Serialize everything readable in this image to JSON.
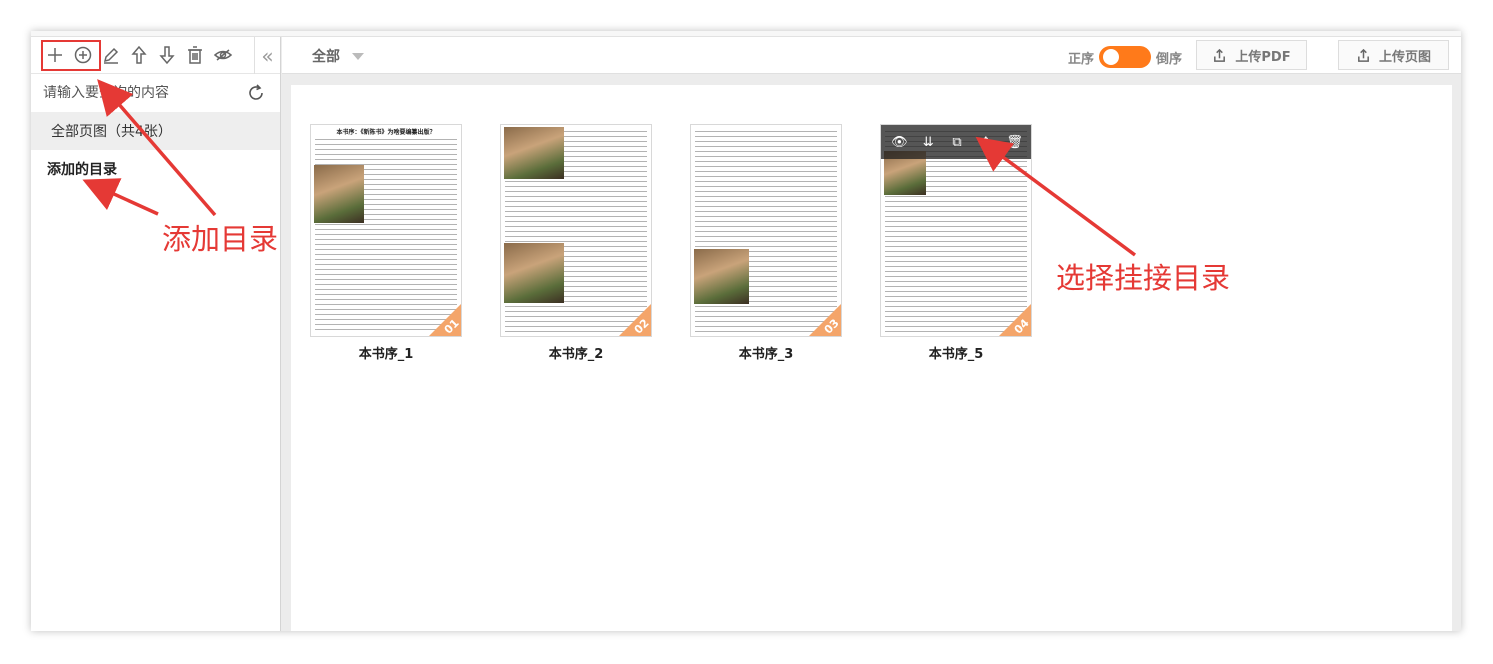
{
  "toolbar": {
    "icons": [
      "plus-icon",
      "add-circle-icon",
      "edit-icon",
      "arrow-up-icon",
      "arrow-down-icon",
      "trash-icon",
      "eye-hidden-icon",
      "collapse-left-icon"
    ]
  },
  "search": {
    "placeholder": "请输入要查询的内容"
  },
  "sidebar": {
    "all_pages": "全部页图（共4张）",
    "added_catalog": "添加的目录"
  },
  "header": {
    "filter_label": "全部",
    "order_asc": "正序",
    "order_desc": "倒序",
    "upload_pdf": "上传PDF",
    "upload_image": "上传页图"
  },
  "pages": [
    {
      "caption": "本书序_1",
      "num": "01",
      "title": "本书序：《新陈书》为啥要编纂出版？"
    },
    {
      "caption": "本书序_2",
      "num": "02",
      "title": ""
    },
    {
      "caption": "本书序_3",
      "num": "03",
      "title": ""
    },
    {
      "caption": "本书序_5",
      "num": "04",
      "title": ""
    }
  ],
  "annotations": {
    "add_catalog": "添加目录",
    "select_catalog": "选择挂接目录"
  },
  "colors": {
    "accent": "#ff7a1a",
    "annotation": "#e53935"
  }
}
